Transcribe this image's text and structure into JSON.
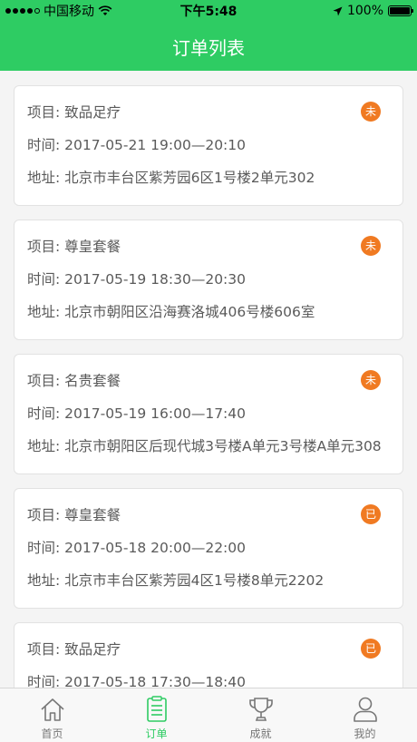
{
  "status_bar": {
    "carrier": "中国移动",
    "time": "下午5:48",
    "battery": "100%",
    "signal_bars": 4
  },
  "header": {
    "title": "订单列表"
  },
  "labels": {
    "project": "项目: ",
    "time": "时间: ",
    "address": "地址: "
  },
  "orders": [
    {
      "project": "致品足疗",
      "time": "2017-05-21 19:00—20:10",
      "address": "北京市丰台区紫芳园6区1号楼2单元302",
      "status": "未"
    },
    {
      "project": "尊皇套餐",
      "time": "2017-05-19 18:30—20:30",
      "address": "北京市朝阳区沿海赛洛城406号楼606室",
      "status": "未"
    },
    {
      "project": "名贵套餐",
      "time": "2017-05-19 16:00—17:40",
      "address": "北京市朝阳区后现代城3号楼A单元3号楼A单元308",
      "status": "未"
    },
    {
      "project": "尊皇套餐",
      "time": "2017-05-18 20:00—22:00",
      "address": "北京市丰台区紫芳园4区1号楼8单元2202",
      "status": "已"
    },
    {
      "project": "致品足疗",
      "time": "2017-05-18 17:30—18:40",
      "address": "",
      "status": "已"
    }
  ],
  "tabbar": {
    "items": [
      {
        "label": "首页",
        "icon": "home-icon"
      },
      {
        "label": "订单",
        "icon": "order-icon"
      },
      {
        "label": "成就",
        "icon": "trophy-icon"
      },
      {
        "label": "我的",
        "icon": "user-icon"
      }
    ],
    "active_index": 1
  },
  "colors": {
    "primary": "#2ecc63",
    "badge": "#f07a22"
  }
}
